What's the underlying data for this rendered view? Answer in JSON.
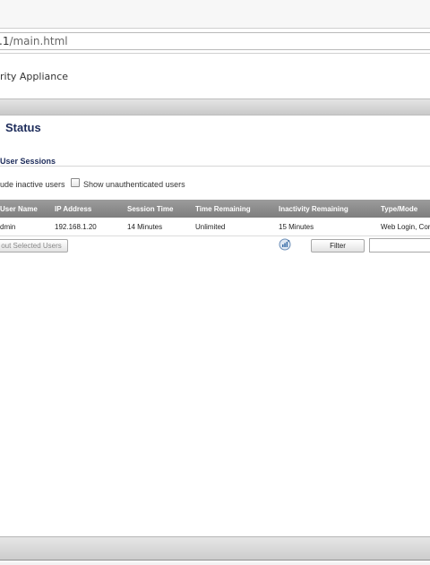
{
  "browser": {
    "url_host": ".1",
    "url_path": "/main.html"
  },
  "app": {
    "brand_text": "rity Appliance"
  },
  "page": {
    "title": "Status",
    "section_title": "User Sessions"
  },
  "options": {
    "include_inactive_label": "ude inactive users",
    "show_unauthenticated_label": "Show unauthenticated users",
    "show_unauthenticated_checked": false
  },
  "table": {
    "columns": [
      "User Name",
      "IP Address",
      "Session Time",
      "Time Remaining",
      "Inactivity Remaining",
      "Type/Mode"
    ],
    "rows": [
      [
        "dmin",
        "192.168.1.20",
        "14 Minutes",
        "Unlimited",
        "15 Minutes",
        "Web Login, Cor"
      ]
    ]
  },
  "actions": {
    "logout_label": "out Selected Users",
    "filter_label": "Filter",
    "filter_value": ""
  },
  "colors": {
    "accent_title": "#1c2b5a",
    "table_header": "#8a8a8a"
  }
}
